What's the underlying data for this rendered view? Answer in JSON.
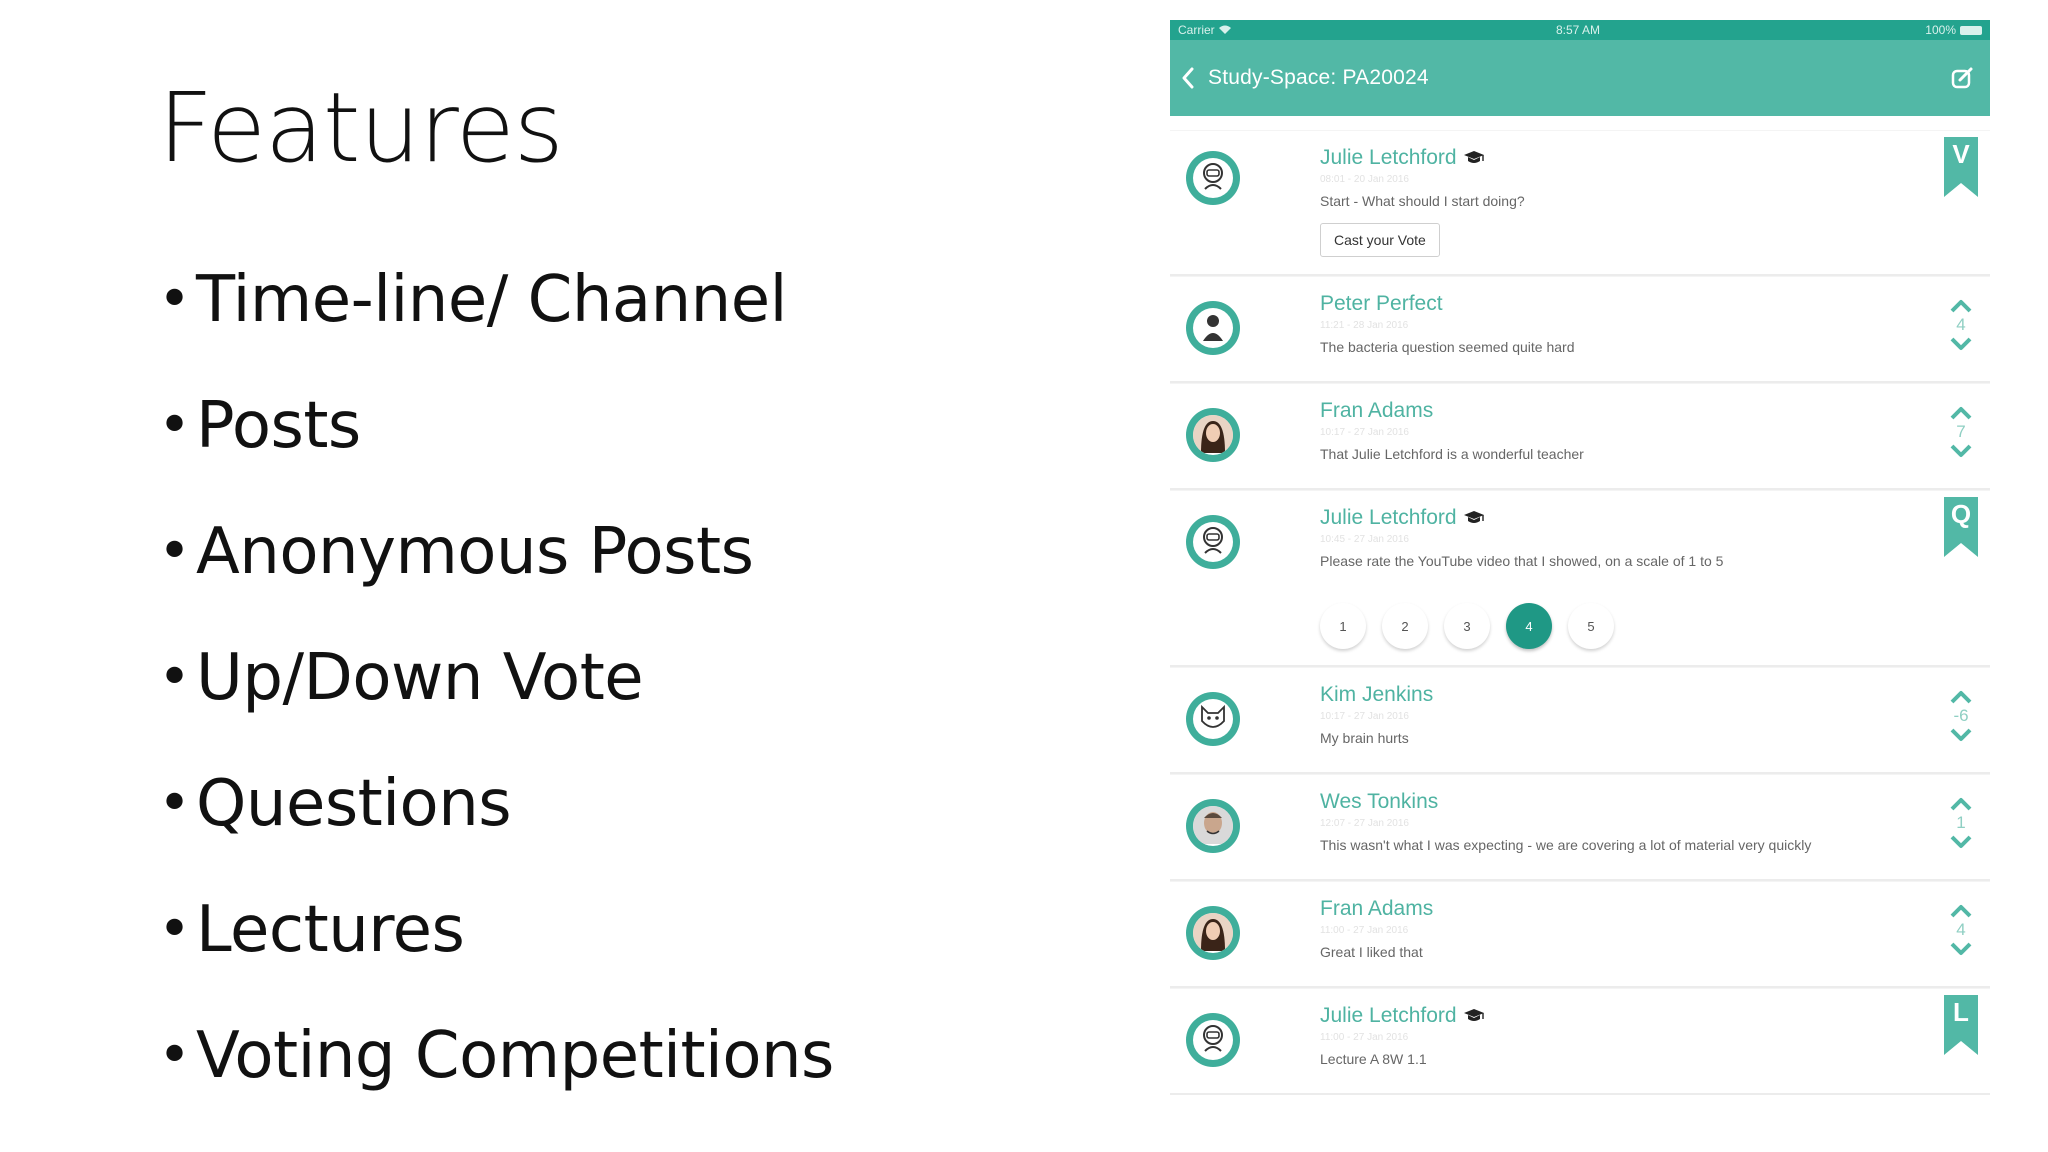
{
  "slide": {
    "title": "Features",
    "bullets": [
      "Time-line/ Channel",
      "Posts",
      "Anonymous Posts",
      "Up/Down Vote",
      "Questions",
      "Lectures",
      "Voting Competitions"
    ]
  },
  "app": {
    "status": {
      "carrier": "Carrier",
      "time": "8:57 AM",
      "battery": "100%"
    },
    "nav": {
      "title": "Study-Space: PA20024"
    },
    "colors": {
      "primary": "#52b8a6",
      "status": "#23a38e",
      "selected": "#1f9885"
    },
    "posts": [
      {
        "name": "Julie Letchford",
        "teacher": true,
        "time": "08:01 - 20 Jan 2016",
        "text": "Start - What should I start doing?",
        "action_label": "Cast your Vote",
        "badge": "V",
        "avatar": "robot-icon"
      },
      {
        "name": "Peter Perfect",
        "teacher": false,
        "time": "11:21 - 28 Jan 2016",
        "text": "The bacteria question seemed quite hard",
        "votes": "4",
        "avatar": "person-icon"
      },
      {
        "name": "Fran Adams",
        "teacher": false,
        "time": "10:17 - 27 Jan 2016",
        "text": "That Julie Letchford is a wonderful teacher",
        "votes": "7",
        "avatar": "photo-icon"
      },
      {
        "name": "Julie Letchford",
        "teacher": true,
        "time": "10:45 - 27 Jan 2016",
        "text": "Please rate the YouTube video that I showed, on a scale of 1 to 5",
        "badge": "Q",
        "avatar": "robot-icon",
        "rating": [
          "1",
          "2",
          "3",
          "4",
          "5"
        ],
        "rating_selected": "4"
      },
      {
        "name": "Kim Jenkins",
        "teacher": false,
        "time": "10:17 - 27 Jan 2016",
        "text": "My brain hurts",
        "votes": "-6",
        "avatar": "cat-icon"
      },
      {
        "name": "Wes Tonkins",
        "teacher": false,
        "time": "12:07 - 27 Jan 2016",
        "text": "This wasn't what I was expecting - we are covering a lot of material very quickly",
        "votes": "1",
        "avatar": "face-icon"
      },
      {
        "name": "Fran Adams",
        "teacher": false,
        "time": "11:00 - 27 Jan 2016",
        "text": "Great I liked that",
        "votes": "4",
        "avatar": "photo-icon"
      },
      {
        "name": "Julie Letchford",
        "teacher": true,
        "time": "11:00 - 27 Jan 2016",
        "text": "Lecture A 8W 1.1",
        "badge": "L",
        "avatar": "robot-icon"
      }
    ]
  }
}
